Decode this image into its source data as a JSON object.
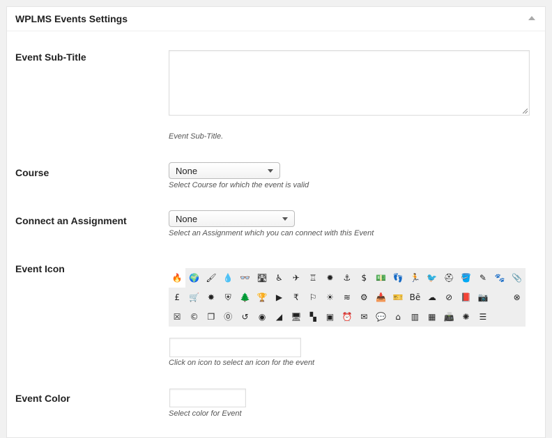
{
  "metabox": {
    "title": "WPLMS Events Settings"
  },
  "fields": {
    "subtitle": {
      "label": "Event Sub-Title",
      "value": "",
      "description": "Event Sub-Title."
    },
    "course": {
      "label": "Course",
      "selected": "None",
      "description": "Select Course for which the event is valid"
    },
    "assignment": {
      "label": "Connect an Assignment",
      "selected": "None",
      "description": "Select an Assignment which you can connect with this Event"
    },
    "icon": {
      "label": "Event Icon",
      "value": "",
      "description": "Click on icon to select an icon for the event",
      "icons": [
        {
          "name": "fire-icon",
          "glyph": "🔥"
        },
        {
          "name": "globe-icon",
          "glyph": "🌍"
        },
        {
          "name": "brush-icon",
          "glyph": "🖌"
        },
        {
          "name": "drop-icon",
          "glyph": "💧"
        },
        {
          "name": "glasses-icon",
          "glyph": "👓"
        },
        {
          "name": "road-icon",
          "glyph": "🛣"
        },
        {
          "name": "wheelchair-icon",
          "glyph": "♿"
        },
        {
          "name": "plane-icon",
          "glyph": "✈"
        },
        {
          "name": "castle-icon",
          "glyph": "♖"
        },
        {
          "name": "certificate-icon",
          "glyph": "✹"
        },
        {
          "name": "anchor-icon",
          "glyph": "⚓"
        },
        {
          "name": "dollar-icon",
          "glyph": "$"
        },
        {
          "name": "money-icon",
          "glyph": "💵"
        },
        {
          "name": "footprint-icon",
          "glyph": "👣"
        },
        {
          "name": "runner-icon",
          "glyph": "🏃"
        },
        {
          "name": "bird-icon",
          "glyph": "🐦"
        },
        {
          "name": "first-aid-icon",
          "glyph": "⛑"
        },
        {
          "name": "paint-bucket-icon",
          "glyph": "🪣"
        },
        {
          "name": "pencil-icon",
          "glyph": "✎"
        },
        {
          "name": "paw-icon",
          "glyph": "🐾"
        },
        {
          "name": "paperclip-icon",
          "glyph": "📎"
        },
        {
          "name": "pound-icon",
          "glyph": "£"
        },
        {
          "name": "cart-icon",
          "glyph": "🛒"
        },
        {
          "name": "star-burst-icon",
          "glyph": "✸"
        },
        {
          "name": "shield-icon",
          "glyph": "⛨"
        },
        {
          "name": "trees-icon",
          "glyph": "🌲"
        },
        {
          "name": "trophy-icon",
          "glyph": "🏆"
        },
        {
          "name": "youtube-icon",
          "glyph": "▶"
        },
        {
          "name": "rupee-icon",
          "glyph": "₹"
        },
        {
          "name": "signpost-icon",
          "glyph": "⚐"
        },
        {
          "name": "sun-icon",
          "glyph": "☀"
        },
        {
          "name": "waves-icon",
          "glyph": "≋"
        },
        {
          "name": "gear-icon",
          "glyph": "⚙"
        },
        {
          "name": "inbox-icon",
          "glyph": "📥"
        },
        {
          "name": "ticket-icon",
          "glyph": "🎫"
        },
        {
          "name": "behance-icon",
          "glyph": "Bē"
        },
        {
          "name": "cloud-icon",
          "glyph": "☁"
        },
        {
          "name": "ban-icon",
          "glyph": "⊘"
        },
        {
          "name": "book-icon",
          "glyph": "📕"
        },
        {
          "name": "camera-icon",
          "glyph": "📷"
        },
        {
          "name": "blank-slot",
          "glyph": ""
        },
        {
          "name": "close-circle-icon",
          "glyph": "⊗"
        },
        {
          "name": "close-square-icon",
          "glyph": "☒"
        },
        {
          "name": "creative-commons-icon",
          "glyph": "©"
        },
        {
          "name": "copy-icon",
          "glyph": "❐"
        },
        {
          "name": "zero-circle-icon",
          "glyph": "⓪"
        },
        {
          "name": "refresh-icon",
          "glyph": "↺"
        },
        {
          "name": "record-icon",
          "glyph": "◉"
        },
        {
          "name": "area-chart-icon",
          "glyph": "◢"
        },
        {
          "name": "monitor-icon",
          "glyph": "🖥"
        },
        {
          "name": "checker-icon",
          "glyph": "▚"
        },
        {
          "name": "instagram-icon",
          "glyph": "▣"
        },
        {
          "name": "alarm-clock-icon",
          "glyph": "⏰"
        },
        {
          "name": "mail-icon",
          "glyph": "✉"
        },
        {
          "name": "chat-bubble-icon",
          "glyph": "💬"
        },
        {
          "name": "tag-icon",
          "glyph": "⌂"
        },
        {
          "name": "columns-icon",
          "glyph": "▥"
        },
        {
          "name": "calculator-icon",
          "glyph": "▦"
        },
        {
          "name": "cash-register-icon",
          "glyph": "📠"
        },
        {
          "name": "brightness-icon",
          "glyph": "✺"
        },
        {
          "name": "list-icon",
          "glyph": "☰"
        }
      ]
    },
    "color": {
      "label": "Event Color",
      "value": "",
      "description": "Select color for Event"
    }
  }
}
